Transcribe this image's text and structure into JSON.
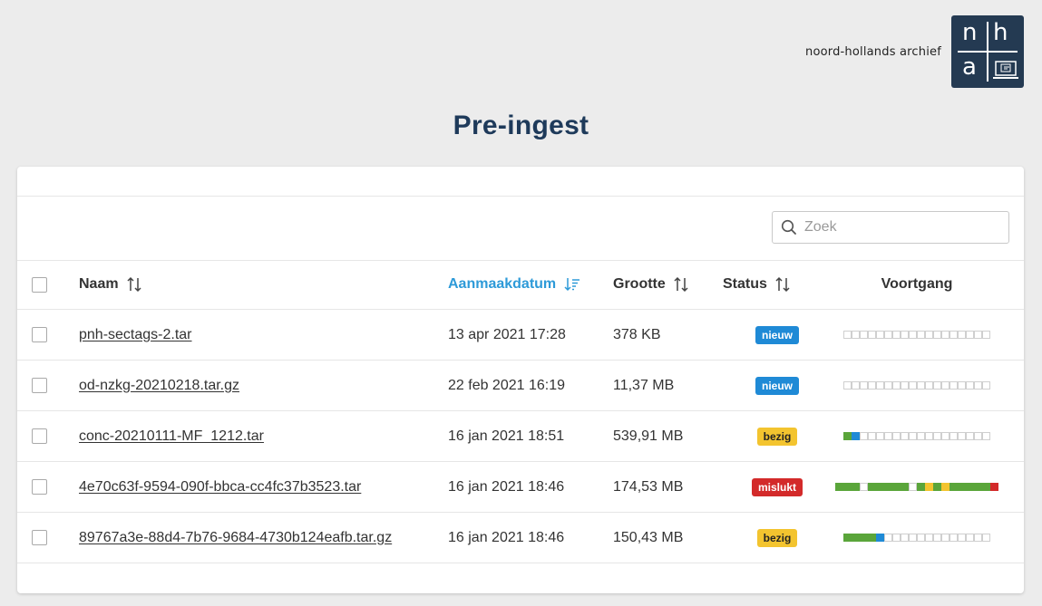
{
  "brand": {
    "name": "noord-hollands archief",
    "logo_letters": [
      "n",
      "h",
      "a"
    ]
  },
  "page_title": "Pre-ingest",
  "search": {
    "placeholder": "Zoek",
    "value": ""
  },
  "columns": {
    "name": "Naam",
    "date": "Aanmaakdatum",
    "size": "Grootte",
    "status": "Status",
    "progress": "Voortgang",
    "sorted_by": "Aanmaakdatum",
    "sort_direction": "descending"
  },
  "colors": {
    "accent": "#2d9ad8",
    "title": "#1e3a5a",
    "new": "#1f8ad6",
    "busy": "#f3c42f",
    "failed": "#d32a2a",
    "done": "#5aa53a"
  },
  "rows": [
    {
      "name": "pnh-sectags-2.tar",
      "date": "13 apr 2021 17:28",
      "size": "378 KB",
      "status": "nieuw",
      "status_type": "new",
      "progress": "eeeeeeeeeeeeeeeeee"
    },
    {
      "name": "od-nzkg-20210218.tar.gz",
      "date": "22 feb 2021 16:19",
      "size": "11,37 MB",
      "status": "nieuw",
      "status_type": "new",
      "progress": "eeeeeeeeeeeeeeeeee"
    },
    {
      "name": "conc-20210111-MF_1212.tar",
      "date": "16 jan 2021 18:51",
      "size": "539,91 MB",
      "status": "bezig",
      "status_type": "busy",
      "progress": "dbeeeeeeeeeeeeeeee"
    },
    {
      "name": "4e70c63f-9594-090f-bbca-cc4fc37b3523.tar",
      "date": "16 jan 2021 18:46",
      "size": "174,53 MB",
      "status": "mislukt",
      "status_type": "failed",
      "progress": "dddedddddedydydddddr"
    },
    {
      "name": "89767a3e-88d4-7b76-9684-4730b124eafb.tar.gz",
      "date": "16 jan 2021 18:46",
      "size": "150,43 MB",
      "status": "bezig",
      "status_type": "busy",
      "progress": "ddddbeeeeeeeeeeeee"
    }
  ]
}
